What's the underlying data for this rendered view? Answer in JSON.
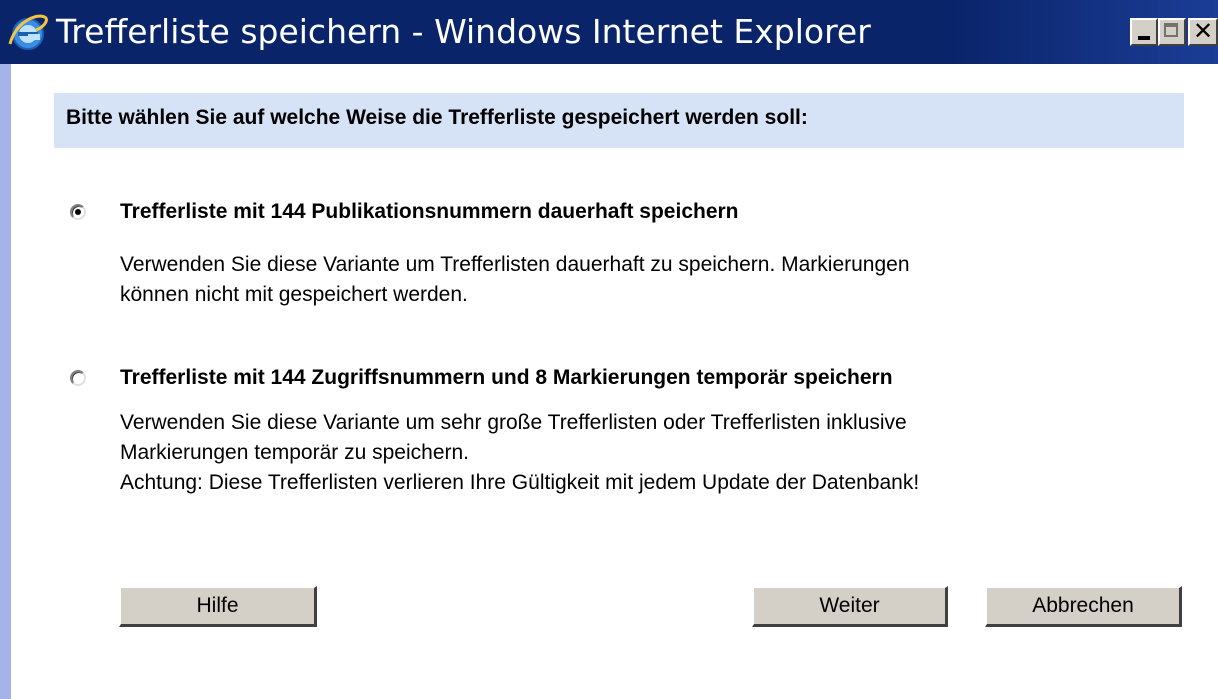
{
  "window": {
    "title": "Trefferliste speichern - Windows Internet Explorer",
    "app_icon": "internet-explorer-icon",
    "controls": {
      "minimize_icon": "minimize-icon",
      "maximize_icon": "maximize-icon",
      "close_glyph": "✕"
    }
  },
  "dialog": {
    "heading": "Bitte wählen Sie auf welche Weise die Trefferliste gespeichert werden soll:",
    "options": [
      {
        "selected": true,
        "title": "Trefferliste mit 144 Publikationsnummern dauerhaft speichern",
        "description_lines": [
          "Verwenden Sie diese Variante um Trefferlisten dauerhaft zu speichern. Markierungen",
          "können nicht mit gespeichert werden."
        ]
      },
      {
        "selected": false,
        "title": "Trefferliste mit 144 Zugriffsnummern und 8 Markierungen temporär speichern",
        "description_lines": [
          "Verwenden Sie diese Variante um sehr große Trefferlisten oder Trefferlisten inklusive",
          "Markierungen temporär zu speichern.",
          "Achtung: Diese Trefferlisten verlieren Ihre Gültigkeit mit jedem Update der Datenbank!"
        ]
      }
    ],
    "buttons": {
      "help": "Hilfe",
      "next": "Weiter",
      "cancel": "Abbrechen"
    }
  },
  "colors": {
    "titlebar": "#0a246a",
    "header_bg": "#d6e2f6",
    "frame_edge": "#a5b4e8",
    "button_face": "#d4d0c8"
  }
}
